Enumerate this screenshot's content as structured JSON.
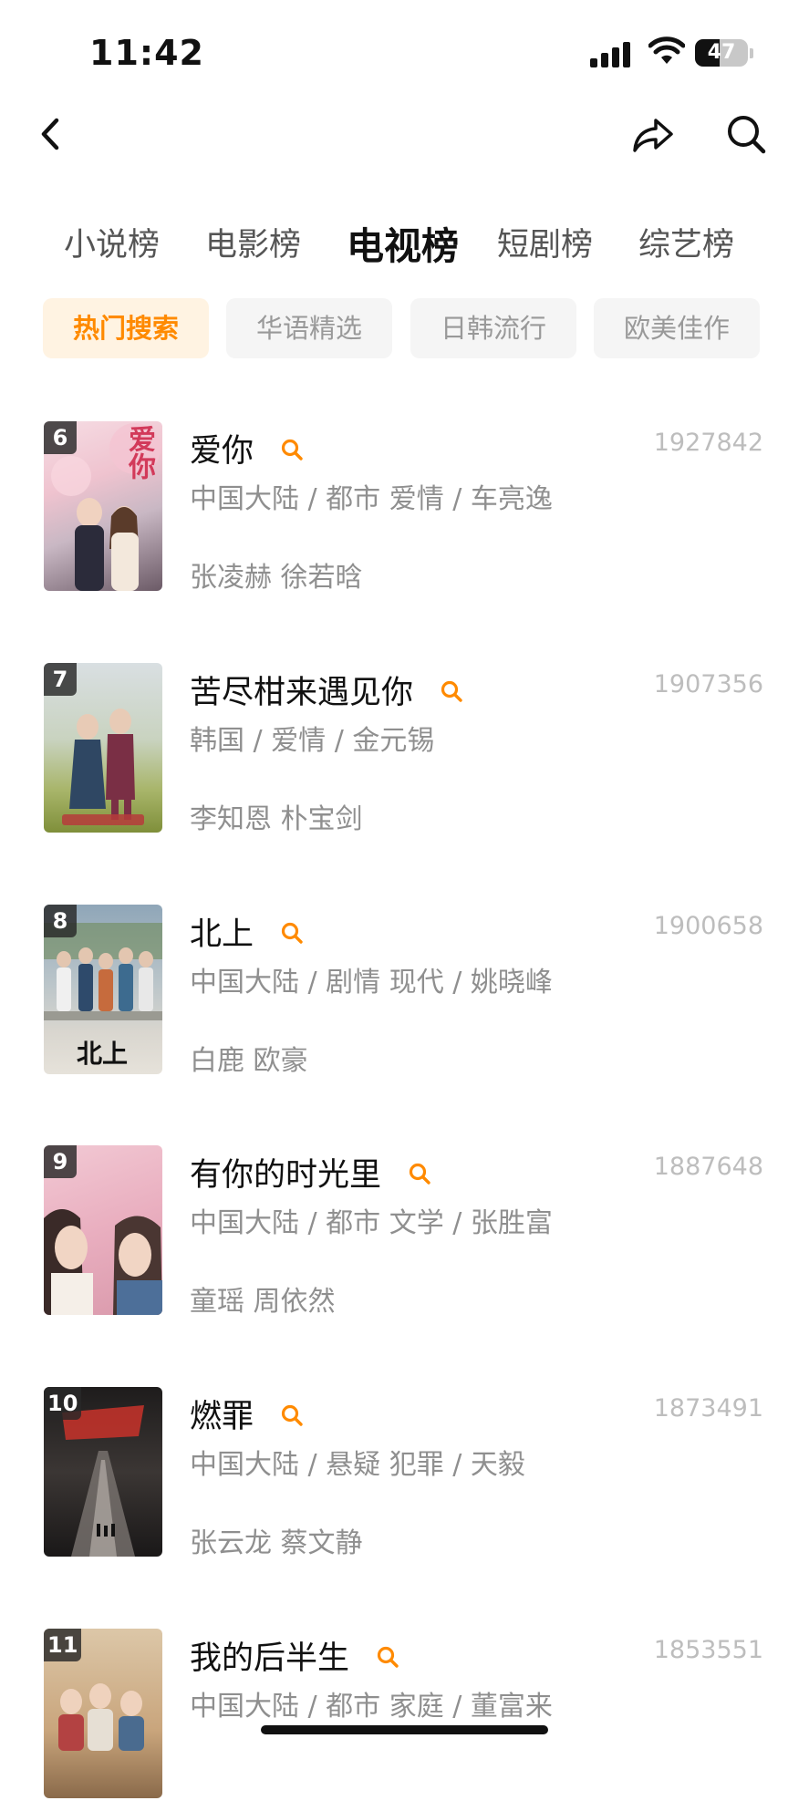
{
  "status_bar": {
    "time": "11:42",
    "battery": "47"
  },
  "nav": {
    "back_icon": "chevron-left-icon",
    "share_icon": "share-icon",
    "search_icon": "search-icon"
  },
  "tabs": [
    {
      "label": "小说榜",
      "active": false
    },
    {
      "label": "电影榜",
      "active": false
    },
    {
      "label": "电视榜",
      "active": true
    },
    {
      "label": "短剧榜",
      "active": false
    },
    {
      "label": "综艺榜",
      "active": false
    }
  ],
  "chips": [
    {
      "label": "热门搜索",
      "active": true
    },
    {
      "label": "华语精选",
      "active": false
    },
    {
      "label": "日韩流行",
      "active": false
    },
    {
      "label": "欧美佳作",
      "active": false
    }
  ],
  "colors": {
    "accent": "#ff8a00",
    "chip_active_bg": "#fff3e2"
  },
  "items": [
    {
      "rank": "6",
      "title": "爱你",
      "meta": "中国大陆 / 都市 爱情 / 车亮逸",
      "cast": "张凌赫 徐若晗",
      "score": "1927842",
      "poster_text": "爱你"
    },
    {
      "rank": "7",
      "title": "苦尽柑来遇见你",
      "meta": "韩国 / 爱情 / 金元锡",
      "cast": "李知恩 朴宝剑",
      "score": "1907356",
      "poster_text": ""
    },
    {
      "rank": "8",
      "title": "北上",
      "meta": "中国大陆 / 剧情 现代 / 姚晓峰",
      "cast": "白鹿 欧豪",
      "score": "1900658",
      "poster_text": "北上"
    },
    {
      "rank": "9",
      "title": "有你的时光里",
      "meta": "中国大陆 / 都市 文学 / 张胜富",
      "cast": "童瑶 周依然",
      "score": "1887648",
      "poster_text": ""
    },
    {
      "rank": "10",
      "title": "燃罪",
      "meta": "中国大陆 / 悬疑 犯罪 / 天毅",
      "cast": "张云龙 蔡文静",
      "score": "1873491",
      "poster_text": ""
    },
    {
      "rank": "11",
      "title": "我的后半生",
      "meta": "中国大陆 / 都市 家庭 / 董富来",
      "cast": "",
      "score": "1853551",
      "poster_text": ""
    }
  ]
}
